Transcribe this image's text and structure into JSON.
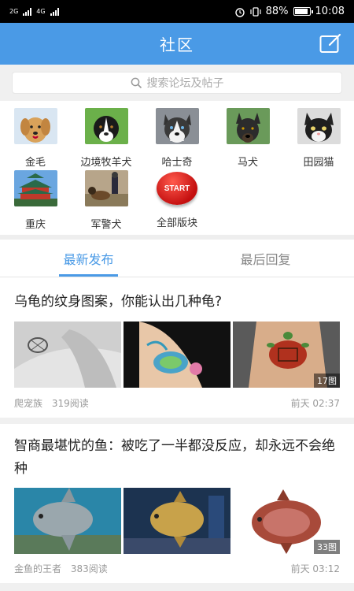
{
  "status": {
    "sim1": "2G",
    "sim2": "4G",
    "battery": "88%",
    "time": "10:08"
  },
  "header": {
    "title": "社区"
  },
  "search": {
    "placeholder": "搜索论坛及帖子"
  },
  "categories": [
    {
      "label": "金毛"
    },
    {
      "label": "边境牧羊犬"
    },
    {
      "label": "哈士奇"
    },
    {
      "label": "马犬"
    },
    {
      "label": "田园猫"
    },
    {
      "label": "重庆"
    },
    {
      "label": "军警犬"
    },
    {
      "label": "全部版块",
      "badge": "START"
    }
  ],
  "tabs": [
    {
      "label": "最新发布",
      "active": true
    },
    {
      "label": "最后回复",
      "active": false
    }
  ],
  "posts": [
    {
      "title": "乌龟的纹身图案，你能认出几种龟?",
      "image_count": "17图",
      "author": "爬宠族",
      "reads": "319阅读",
      "time": "前天 02:37"
    },
    {
      "title": "智商最堪忧的鱼：被吃了一半都没反应，却永远不会绝种",
      "image_count": "33图",
      "author": "金鱼的王者",
      "reads": "383阅读",
      "time": "前天 03:12"
    }
  ],
  "colors": {
    "accent": "#4a9ae6",
    "statusbar": "#000000"
  }
}
